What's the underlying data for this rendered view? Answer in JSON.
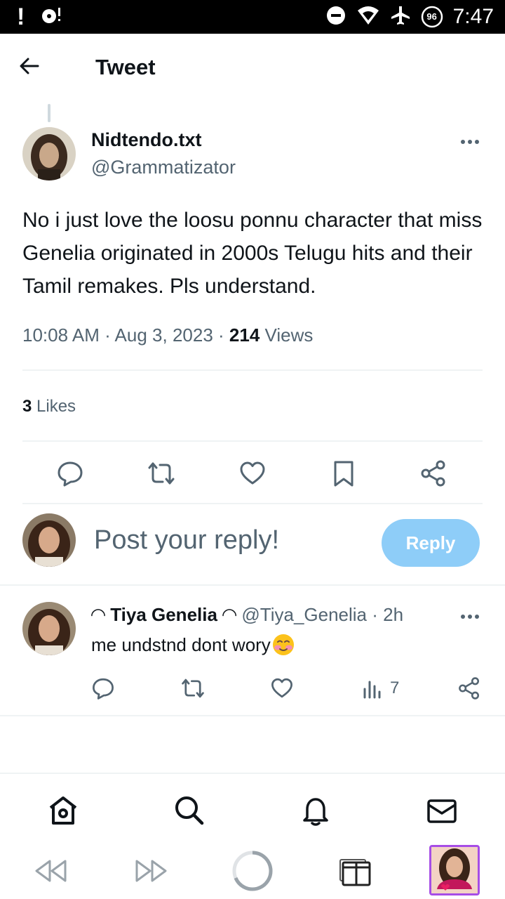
{
  "status_bar": {
    "left_icon": "!",
    "battery_level": "96",
    "time": "7:47",
    "icons": [
      "alert-icon",
      "media-icon",
      "dnd-icon",
      "wifi-icon",
      "airplane-icon",
      "battery-icon"
    ]
  },
  "header": {
    "title": "Tweet"
  },
  "tweet": {
    "author_name": "Nidtendo.txt",
    "author_handle": "@Grammatizator",
    "text": "No i just love the loosu ponnu character that miss Genelia originated in 2000s Telugu hits and their Tamil remakes. Pls understand.",
    "time": "10:08 AM",
    "date": "Aug 3, 2023",
    "views_count": "214",
    "views_label": "Views",
    "likes_count": "3",
    "likes_label": "Likes"
  },
  "composer": {
    "placeholder": "Post your reply!",
    "reply_label": "Reply"
  },
  "reply": {
    "name": "◠ Tiya Genelia ◠",
    "handle": "@Tiya_Genelia",
    "age": "2h",
    "text": "me undstnd dont wory",
    "views": "7"
  },
  "colors": {
    "accent": "#1d9bf0",
    "reply_button": "#8ecdf8",
    "muted_text": "#536471",
    "divider": "#eff3f4"
  },
  "bottom_nav": [
    "home-icon",
    "search-icon",
    "notifications-icon",
    "messages-icon"
  ],
  "system_bar": [
    "rewind-icon",
    "fast-forward-icon",
    "loading-icon",
    "tabs-icon",
    "profile-thumbnail"
  ]
}
